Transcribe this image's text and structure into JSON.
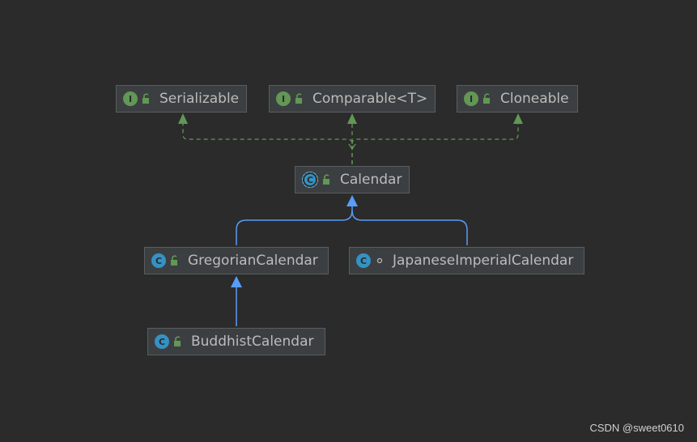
{
  "colors": {
    "background": "#2b2b2b",
    "node_fill": "#3c3f41",
    "node_border": "#5a5d60",
    "implements_edge": "#629755",
    "extends_edge": "#589df6",
    "text": "#bbbbbb"
  },
  "nodes": {
    "serializable": {
      "label": "Serializable",
      "kind": "interface",
      "kind_letter": "I",
      "visibility": "public"
    },
    "comparable": {
      "label": "Comparable<T>",
      "kind": "interface",
      "kind_letter": "I",
      "visibility": "public"
    },
    "cloneable": {
      "label": "Cloneable",
      "kind": "interface",
      "kind_letter": "I",
      "visibility": "public"
    },
    "calendar": {
      "label": "Calendar",
      "kind": "abstract-class",
      "kind_letter": "C",
      "visibility": "public"
    },
    "gregorian": {
      "label": "GregorianCalendar",
      "kind": "class",
      "kind_letter": "C",
      "visibility": "public"
    },
    "japanese": {
      "label": "JapaneseImperialCalendar",
      "kind": "class",
      "kind_letter": "C",
      "visibility": "package-private"
    },
    "buddhist": {
      "label": "BuddhistCalendar",
      "kind": "class",
      "kind_letter": "C",
      "visibility": "public"
    }
  },
  "edges": [
    {
      "from": "calendar",
      "to": "serializable",
      "type": "implements"
    },
    {
      "from": "calendar",
      "to": "comparable",
      "type": "implements"
    },
    {
      "from": "calendar",
      "to": "cloneable",
      "type": "implements"
    },
    {
      "from": "gregorian",
      "to": "calendar",
      "type": "extends"
    },
    {
      "from": "japanese",
      "to": "calendar",
      "type": "extends"
    },
    {
      "from": "buddhist",
      "to": "gregorian",
      "type": "extends"
    }
  ],
  "watermark": "CSDN @sweet0610"
}
